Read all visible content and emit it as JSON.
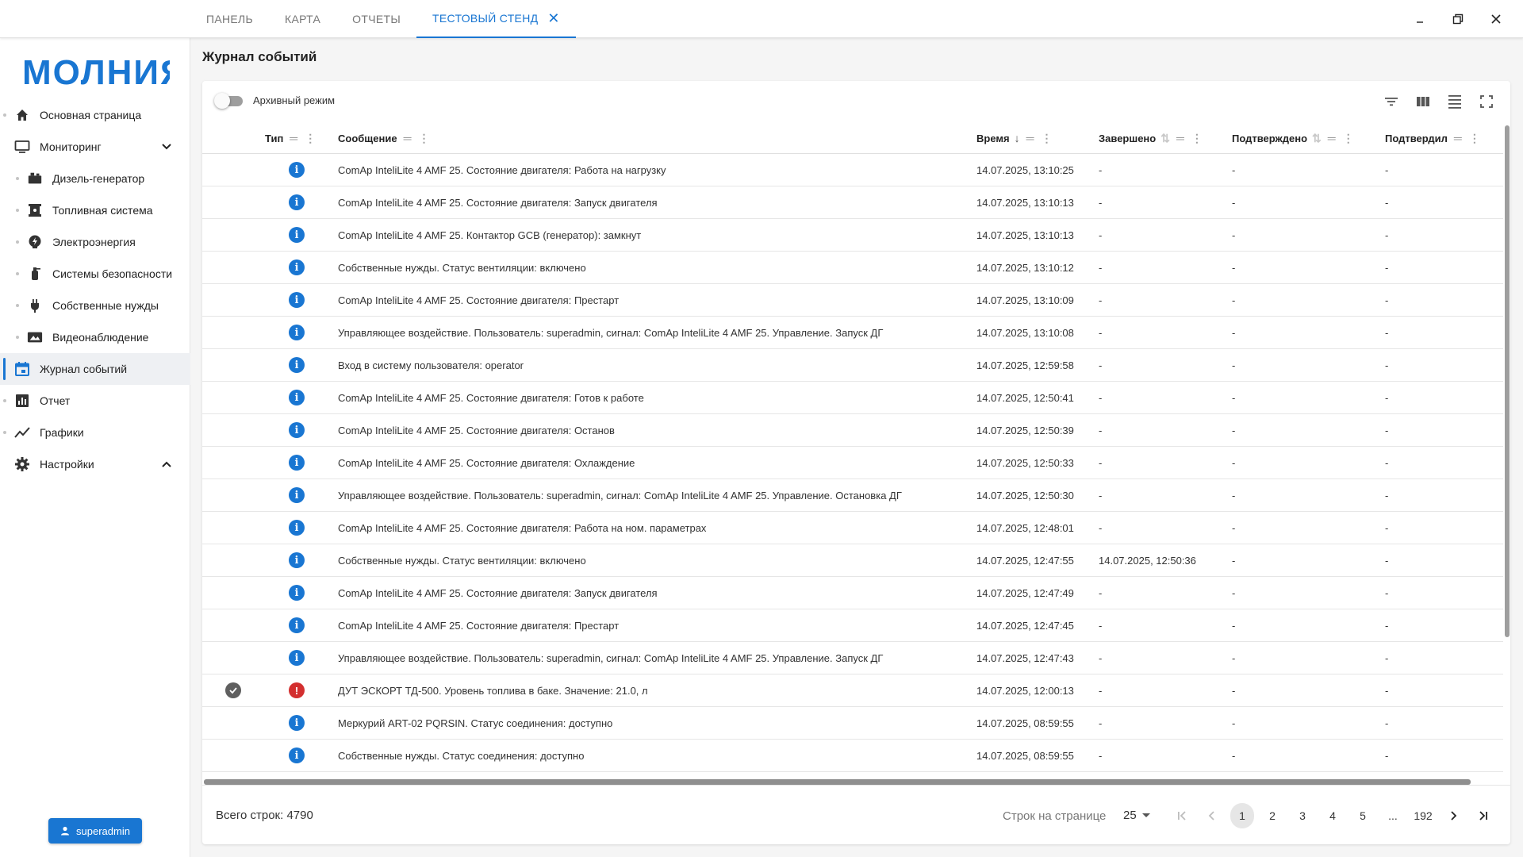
{
  "tabs": [
    {
      "label": "ПАНЕЛЬ"
    },
    {
      "label": "КАРТА"
    },
    {
      "label": "ОТЧЕТЫ"
    },
    {
      "label": "ТЕСТОВЫЙ СТЕНД",
      "active": true,
      "closable": true
    }
  ],
  "window_controls": [
    "minimize-icon",
    "restore-icon",
    "close-icon"
  ],
  "logo": {
    "text": "МОЛНИЯ",
    "color": "#1976d2"
  },
  "sidebar": {
    "items": [
      {
        "label": "Основная страница",
        "icon": "home-icon"
      },
      {
        "label": "Мониторинг",
        "icon": "monitor-icon",
        "expand": "chevron-down-icon"
      },
      {
        "label": "Дизель-генератор",
        "icon": "generator-icon",
        "sub": true
      },
      {
        "label": "Топливная система",
        "icon": "fuel-icon",
        "sub": true
      },
      {
        "label": "Электроэнергия",
        "icon": "power-icon",
        "sub": true
      },
      {
        "label": "Системы безопасности",
        "icon": "extinguisher-icon",
        "sub": true
      },
      {
        "label": "Собственные нужды",
        "icon": "plug-icon",
        "sub": true
      },
      {
        "label": "Видеонаблюдение",
        "icon": "camera-icon",
        "sub": true
      },
      {
        "label": "Журнал событий",
        "icon": "calendar-icon",
        "active": true
      },
      {
        "label": "Отчет",
        "icon": "report-icon"
      },
      {
        "label": "Графики",
        "icon": "chart-line-icon"
      },
      {
        "label": "Настройки",
        "icon": "gear-icon",
        "expand": "chevron-up-icon"
      }
    ]
  },
  "user": {
    "name": "superadmin"
  },
  "page": {
    "title": "Журнал событий"
  },
  "toolbar": {
    "archive_label": "Архивный режим",
    "archive_on": false,
    "icons": [
      "filter-icon",
      "columns-icon",
      "density-icon",
      "fullscreen-icon"
    ]
  },
  "table": {
    "columns": {
      "type": "Тип",
      "message": "Сообщение",
      "time": "Время",
      "done": "Завершено",
      "confirmed": "Подтверждено",
      "confirmed_by": "Подтвердил"
    },
    "rows": [
      {
        "ack": false,
        "type": "info",
        "message": "ComAp InteliLite 4 AMF 25. Состояние двигателя: Работа на нагрузку",
        "time": "14.07.2025, 13:10:25",
        "done": "-",
        "confirmed": "-",
        "confirmed_by": "-"
      },
      {
        "ack": false,
        "type": "info",
        "message": "ComAp InteliLite 4 AMF 25. Состояние двигателя: Запуск двигателя",
        "time": "14.07.2025, 13:10:13",
        "done": "-",
        "confirmed": "-",
        "confirmed_by": "-"
      },
      {
        "ack": false,
        "type": "info",
        "message": "ComAp InteliLite 4 AMF 25. Контактор GCB (генератор): замкнут",
        "time": "14.07.2025, 13:10:13",
        "done": "-",
        "confirmed": "-",
        "confirmed_by": "-"
      },
      {
        "ack": false,
        "type": "info",
        "message": "Собственные нужды. Статус вентиляции: включено",
        "time": "14.07.2025, 13:10:12",
        "done": "-",
        "confirmed": "-",
        "confirmed_by": "-"
      },
      {
        "ack": false,
        "type": "info",
        "message": "ComAp InteliLite 4 AMF 25. Состояние двигателя: Престарт",
        "time": "14.07.2025, 13:10:09",
        "done": "-",
        "confirmed": "-",
        "confirmed_by": "-"
      },
      {
        "ack": false,
        "type": "info",
        "message": "Управляющее воздействие. Пользователь: superadmin, сигнал: ComAp InteliLite 4 AMF 25. Управление. Запуск ДГ",
        "time": "14.07.2025, 13:10:08",
        "done": "-",
        "confirmed": "-",
        "confirmed_by": "-"
      },
      {
        "ack": false,
        "type": "info",
        "message": "Вход в систему пользователя: operator",
        "time": "14.07.2025, 12:59:58",
        "done": "-",
        "confirmed": "-",
        "confirmed_by": "-"
      },
      {
        "ack": false,
        "type": "info",
        "message": "ComAp InteliLite 4 AMF 25. Состояние двигателя: Готов к работе",
        "time": "14.07.2025, 12:50:41",
        "done": "-",
        "confirmed": "-",
        "confirmed_by": "-"
      },
      {
        "ack": false,
        "type": "info",
        "message": "ComAp InteliLite 4 AMF 25. Состояние двигателя: Останов",
        "time": "14.07.2025, 12:50:39",
        "done": "-",
        "confirmed": "-",
        "confirmed_by": "-"
      },
      {
        "ack": false,
        "type": "info",
        "message": "ComAp InteliLite 4 AMF 25. Состояние двигателя: Охлаждение",
        "time": "14.07.2025, 12:50:33",
        "done": "-",
        "confirmed": "-",
        "confirmed_by": "-"
      },
      {
        "ack": false,
        "type": "info",
        "message": "Управляющее воздействие. Пользователь: superadmin, сигнал: ComAp InteliLite 4 AMF 25. Управление. Остановка ДГ",
        "time": "14.07.2025, 12:50:30",
        "done": "-",
        "confirmed": "-",
        "confirmed_by": "-"
      },
      {
        "ack": false,
        "type": "info",
        "message": "ComAp InteliLite 4 AMF 25. Состояние двигателя: Работа на ном. параметрах",
        "time": "14.07.2025, 12:48:01",
        "done": "-",
        "confirmed": "-",
        "confirmed_by": "-"
      },
      {
        "ack": false,
        "type": "info",
        "message": "Собственные нужды. Статус вентиляции: включено",
        "time": "14.07.2025, 12:47:55",
        "done": "14.07.2025, 12:50:36",
        "confirmed": "-",
        "confirmed_by": "-"
      },
      {
        "ack": false,
        "type": "info",
        "message": "ComAp InteliLite 4 AMF 25. Состояние двигателя: Запуск двигателя",
        "time": "14.07.2025, 12:47:49",
        "done": "-",
        "confirmed": "-",
        "confirmed_by": "-"
      },
      {
        "ack": false,
        "type": "info",
        "message": "ComAp InteliLite 4 AMF 25. Состояние двигателя: Престарт",
        "time": "14.07.2025, 12:47:45",
        "done": "-",
        "confirmed": "-",
        "confirmed_by": "-"
      },
      {
        "ack": false,
        "type": "info",
        "message": "Управляющее воздействие. Пользователь: superadmin, сигнал: ComAp InteliLite 4 AMF 25. Управление. Запуск ДГ",
        "time": "14.07.2025, 12:47:43",
        "done": "-",
        "confirmed": "-",
        "confirmed_by": "-"
      },
      {
        "ack": true,
        "type": "error",
        "message": "ДУТ ЭСКОРТ ТД-500. Уровень топлива в баке. Значение: 21.0, л",
        "time": "14.07.2025, 12:00:13",
        "done": "-",
        "confirmed": "-",
        "confirmed_by": "-"
      },
      {
        "ack": false,
        "type": "info",
        "message": "Меркурий ART-02 PQRSIN. Статус соединения: доступно",
        "time": "14.07.2025, 08:59:55",
        "done": "-",
        "confirmed": "-",
        "confirmed_by": "-"
      },
      {
        "ack": false,
        "type": "info",
        "message": "Собственные нужды. Статус соединения: доступно",
        "time": "14.07.2025, 08:59:55",
        "done": "-",
        "confirmed": "-",
        "confirmed_by": "-"
      }
    ]
  },
  "footer": {
    "total_label": "Всего строк: 4790",
    "rows_per_page_label": "Строк на странице",
    "rows_per_page": "25",
    "pages": [
      "1",
      "2",
      "3",
      "4",
      "5",
      "...",
      "192"
    ],
    "current_page": "1"
  },
  "colors": {
    "accent": "#1976d2",
    "error": "#d32f2f"
  }
}
